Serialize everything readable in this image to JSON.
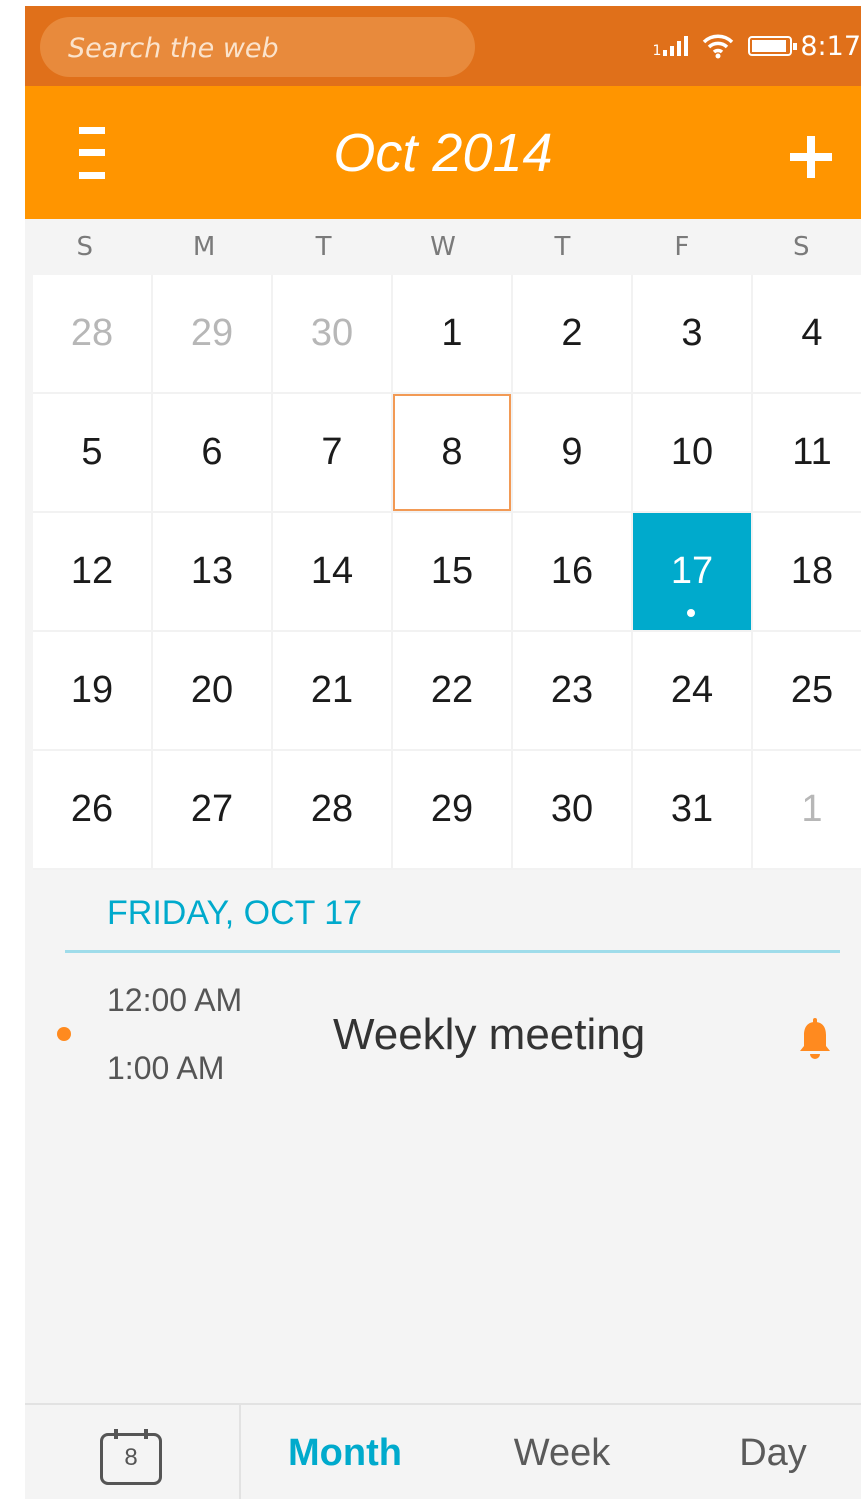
{
  "status_bar": {
    "search_placeholder": "Search the web",
    "signal_sim": "1",
    "time": "8:17"
  },
  "header": {
    "title": "Oct 2014",
    "menu_icon": "hamburger-icon",
    "add_icon": "plus-icon"
  },
  "calendar": {
    "weekdays": [
      "S",
      "M",
      "T",
      "W",
      "T",
      "F",
      "S"
    ],
    "weeks": [
      [
        "28",
        "29",
        "30",
        "1",
        "2",
        "3",
        "4"
      ],
      [
        "5",
        "6",
        "7",
        "8",
        "9",
        "10",
        "11"
      ],
      [
        "12",
        "13",
        "14",
        "15",
        "16",
        "17",
        "18"
      ],
      [
        "19",
        "20",
        "21",
        "22",
        "23",
        "24",
        "25"
      ],
      [
        "26",
        "27",
        "28",
        "29",
        "30",
        "31",
        "1"
      ]
    ]
  },
  "agenda": {
    "heading": "FRIDAY, OCT 17",
    "events": [
      {
        "start": "12:00 AM",
        "end": "1:00 AM",
        "title": "Weekly meeting",
        "icon": "bell-icon"
      }
    ]
  },
  "tabs": {
    "today_icon_number": "8",
    "month": "Month",
    "week": "Week",
    "day": "Day",
    "active": "Month"
  },
  "colors": {
    "status_bar": "#e0701a",
    "header": "#ff9500",
    "accent": "#00aacc",
    "today_outline": "#f29a55",
    "event_dot": "#ff8a1f"
  }
}
